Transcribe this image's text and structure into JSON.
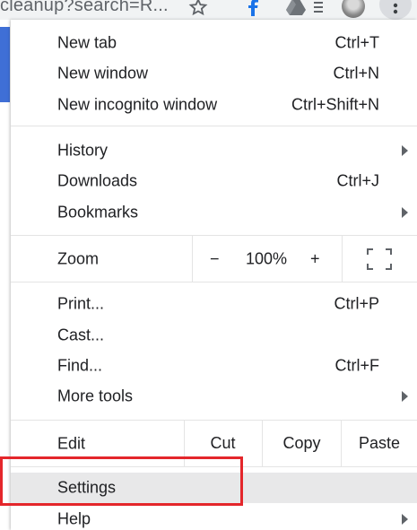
{
  "toolbar": {
    "omnibox_text": "cleanup?search=R...",
    "icons": [
      "star-icon",
      "extension-f-icon",
      "drive-icon",
      "menu-icon",
      "avatar",
      "kebab-menu-icon"
    ]
  },
  "menu": {
    "new_tab": {
      "label": "New tab",
      "shortcut": "Ctrl+T"
    },
    "new_window": {
      "label": "New window",
      "shortcut": "Ctrl+N"
    },
    "new_incognito": {
      "label": "New incognito window",
      "shortcut": "Ctrl+Shift+N"
    },
    "history": {
      "label": "History"
    },
    "downloads": {
      "label": "Downloads",
      "shortcut": "Ctrl+J"
    },
    "bookmarks": {
      "label": "Bookmarks"
    },
    "zoom": {
      "label": "Zoom",
      "minus": "−",
      "level": "100%",
      "plus": "+"
    },
    "print": {
      "label": "Print...",
      "shortcut": "Ctrl+P"
    },
    "cast": {
      "label": "Cast..."
    },
    "find": {
      "label": "Find...",
      "shortcut": "Ctrl+F"
    },
    "more_tools": {
      "label": "More tools"
    },
    "edit": {
      "label": "Edit",
      "cut": "Cut",
      "copy": "Copy",
      "paste": "Paste"
    },
    "settings": {
      "label": "Settings"
    },
    "help": {
      "label": "Help"
    }
  },
  "colors": {
    "highlight_bg": "#e8e8e9",
    "annotation_red": "#e4262b",
    "accent_blue": "#3f6fd6"
  }
}
